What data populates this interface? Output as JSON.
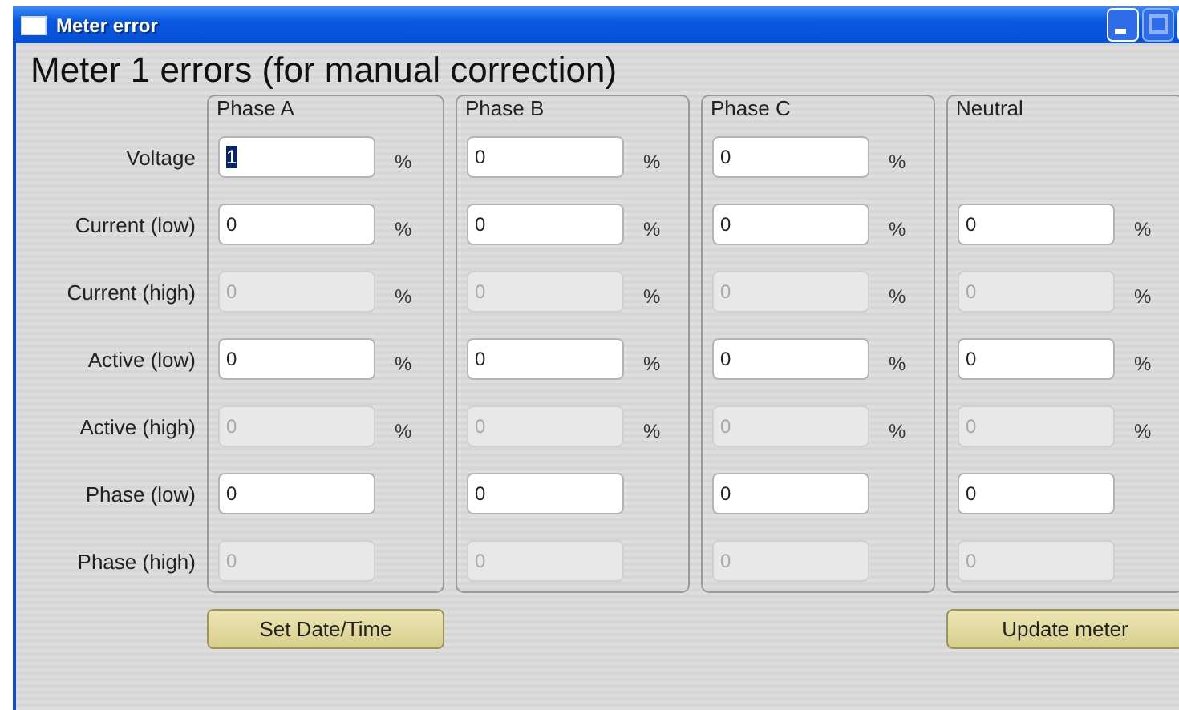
{
  "window": {
    "title": "Meter error"
  },
  "heading": "Meter 1 errors (for manual correction)",
  "row_labels": [
    "Voltage",
    "Current (low)",
    "Current (high)",
    "Active (low)",
    "Active (high)",
    "Phase (low)",
    "Phase (high)"
  ],
  "groups": [
    {
      "title": "Phase A",
      "cells": [
        {
          "kind": "field",
          "value": "1",
          "disabled": false,
          "focused": true,
          "unit": "%"
        },
        {
          "kind": "field",
          "value": "0",
          "disabled": false,
          "focused": false,
          "unit": "%"
        },
        {
          "kind": "field",
          "value": "0",
          "disabled": true,
          "focused": false,
          "unit": "%"
        },
        {
          "kind": "field",
          "value": "0",
          "disabled": false,
          "focused": false,
          "unit": "%"
        },
        {
          "kind": "field",
          "value": "0",
          "disabled": true,
          "focused": false,
          "unit": "%"
        },
        {
          "kind": "field",
          "value": "0",
          "disabled": false,
          "focused": false
        },
        {
          "kind": "field",
          "value": "0",
          "disabled": true,
          "focused": false
        }
      ]
    },
    {
      "title": "Phase B",
      "cells": [
        {
          "kind": "field",
          "value": "0",
          "disabled": false,
          "focused": false,
          "unit": "%"
        },
        {
          "kind": "field",
          "value": "0",
          "disabled": false,
          "focused": false,
          "unit": "%"
        },
        {
          "kind": "field",
          "value": "0",
          "disabled": true,
          "focused": false,
          "unit": "%"
        },
        {
          "kind": "field",
          "value": "0",
          "disabled": false,
          "focused": false,
          "unit": "%"
        },
        {
          "kind": "field",
          "value": "0",
          "disabled": true,
          "focused": false,
          "unit": "%"
        },
        {
          "kind": "field",
          "value": "0",
          "disabled": false,
          "focused": false
        },
        {
          "kind": "field",
          "value": "0",
          "disabled": true,
          "focused": false
        }
      ]
    },
    {
      "title": "Phase C",
      "cells": [
        {
          "kind": "field",
          "value": "0",
          "disabled": false,
          "focused": false,
          "unit": "%"
        },
        {
          "kind": "field",
          "value": "0",
          "disabled": false,
          "focused": false,
          "unit": "%"
        },
        {
          "kind": "field",
          "value": "0",
          "disabled": true,
          "focused": false,
          "unit": "%"
        },
        {
          "kind": "field",
          "value": "0",
          "disabled": false,
          "focused": false,
          "unit": "%"
        },
        {
          "kind": "field",
          "value": "0",
          "disabled": true,
          "focused": false,
          "unit": "%"
        },
        {
          "kind": "field",
          "value": "0",
          "disabled": false,
          "focused": false
        },
        {
          "kind": "field",
          "value": "0",
          "disabled": true,
          "focused": false
        }
      ]
    },
    {
      "title": "Neutral",
      "cells": [
        {
          "kind": "blank"
        },
        {
          "kind": "field",
          "value": "0",
          "disabled": false,
          "focused": false,
          "unit": "%"
        },
        {
          "kind": "field",
          "value": "0",
          "disabled": true,
          "focused": false,
          "unit": "%"
        },
        {
          "kind": "field",
          "value": "0",
          "disabled": false,
          "focused": false,
          "unit": "%"
        },
        {
          "kind": "field",
          "value": "0",
          "disabled": true,
          "focused": false,
          "unit": "%"
        },
        {
          "kind": "field",
          "value": "0",
          "disabled": false,
          "focused": false
        },
        {
          "kind": "field",
          "value": "0",
          "disabled": true,
          "focused": false
        }
      ]
    }
  ],
  "buttons": {
    "left": "Set Date/Time",
    "right": "Update meter"
  }
}
